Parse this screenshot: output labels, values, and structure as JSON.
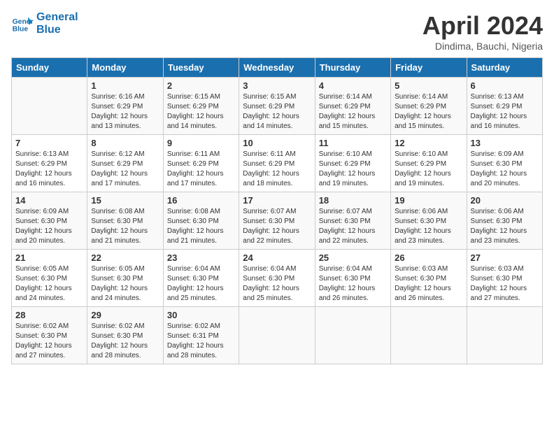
{
  "header": {
    "logo_line1": "General",
    "logo_line2": "Blue",
    "month_title": "April 2024",
    "location": "Dindima, Bauchi, Nigeria"
  },
  "days_of_week": [
    "Sunday",
    "Monday",
    "Tuesday",
    "Wednesday",
    "Thursday",
    "Friday",
    "Saturday"
  ],
  "weeks": [
    [
      {
        "day": "",
        "info": ""
      },
      {
        "day": "1",
        "info": "Sunrise: 6:16 AM\nSunset: 6:29 PM\nDaylight: 12 hours\nand 13 minutes."
      },
      {
        "day": "2",
        "info": "Sunrise: 6:15 AM\nSunset: 6:29 PM\nDaylight: 12 hours\nand 14 minutes."
      },
      {
        "day": "3",
        "info": "Sunrise: 6:15 AM\nSunset: 6:29 PM\nDaylight: 12 hours\nand 14 minutes."
      },
      {
        "day": "4",
        "info": "Sunrise: 6:14 AM\nSunset: 6:29 PM\nDaylight: 12 hours\nand 15 minutes."
      },
      {
        "day": "5",
        "info": "Sunrise: 6:14 AM\nSunset: 6:29 PM\nDaylight: 12 hours\nand 15 minutes."
      },
      {
        "day": "6",
        "info": "Sunrise: 6:13 AM\nSunset: 6:29 PM\nDaylight: 12 hours\nand 16 minutes."
      }
    ],
    [
      {
        "day": "7",
        "info": "Sunrise: 6:13 AM\nSunset: 6:29 PM\nDaylight: 12 hours\nand 16 minutes."
      },
      {
        "day": "8",
        "info": "Sunrise: 6:12 AM\nSunset: 6:29 PM\nDaylight: 12 hours\nand 17 minutes."
      },
      {
        "day": "9",
        "info": "Sunrise: 6:11 AM\nSunset: 6:29 PM\nDaylight: 12 hours\nand 17 minutes."
      },
      {
        "day": "10",
        "info": "Sunrise: 6:11 AM\nSunset: 6:29 PM\nDaylight: 12 hours\nand 18 minutes."
      },
      {
        "day": "11",
        "info": "Sunrise: 6:10 AM\nSunset: 6:29 PM\nDaylight: 12 hours\nand 19 minutes."
      },
      {
        "day": "12",
        "info": "Sunrise: 6:10 AM\nSunset: 6:29 PM\nDaylight: 12 hours\nand 19 minutes."
      },
      {
        "day": "13",
        "info": "Sunrise: 6:09 AM\nSunset: 6:30 PM\nDaylight: 12 hours\nand 20 minutes."
      }
    ],
    [
      {
        "day": "14",
        "info": "Sunrise: 6:09 AM\nSunset: 6:30 PM\nDaylight: 12 hours\nand 20 minutes."
      },
      {
        "day": "15",
        "info": "Sunrise: 6:08 AM\nSunset: 6:30 PM\nDaylight: 12 hours\nand 21 minutes."
      },
      {
        "day": "16",
        "info": "Sunrise: 6:08 AM\nSunset: 6:30 PM\nDaylight: 12 hours\nand 21 minutes."
      },
      {
        "day": "17",
        "info": "Sunrise: 6:07 AM\nSunset: 6:30 PM\nDaylight: 12 hours\nand 22 minutes."
      },
      {
        "day": "18",
        "info": "Sunrise: 6:07 AM\nSunset: 6:30 PM\nDaylight: 12 hours\nand 22 minutes."
      },
      {
        "day": "19",
        "info": "Sunrise: 6:06 AM\nSunset: 6:30 PM\nDaylight: 12 hours\nand 23 minutes."
      },
      {
        "day": "20",
        "info": "Sunrise: 6:06 AM\nSunset: 6:30 PM\nDaylight: 12 hours\nand 23 minutes."
      }
    ],
    [
      {
        "day": "21",
        "info": "Sunrise: 6:05 AM\nSunset: 6:30 PM\nDaylight: 12 hours\nand 24 minutes."
      },
      {
        "day": "22",
        "info": "Sunrise: 6:05 AM\nSunset: 6:30 PM\nDaylight: 12 hours\nand 24 minutes."
      },
      {
        "day": "23",
        "info": "Sunrise: 6:04 AM\nSunset: 6:30 PM\nDaylight: 12 hours\nand 25 minutes."
      },
      {
        "day": "24",
        "info": "Sunrise: 6:04 AM\nSunset: 6:30 PM\nDaylight: 12 hours\nand 25 minutes."
      },
      {
        "day": "25",
        "info": "Sunrise: 6:04 AM\nSunset: 6:30 PM\nDaylight: 12 hours\nand 26 minutes."
      },
      {
        "day": "26",
        "info": "Sunrise: 6:03 AM\nSunset: 6:30 PM\nDaylight: 12 hours\nand 26 minutes."
      },
      {
        "day": "27",
        "info": "Sunrise: 6:03 AM\nSunset: 6:30 PM\nDaylight: 12 hours\nand 27 minutes."
      }
    ],
    [
      {
        "day": "28",
        "info": "Sunrise: 6:02 AM\nSunset: 6:30 PM\nDaylight: 12 hours\nand 27 minutes."
      },
      {
        "day": "29",
        "info": "Sunrise: 6:02 AM\nSunset: 6:30 PM\nDaylight: 12 hours\nand 28 minutes."
      },
      {
        "day": "30",
        "info": "Sunrise: 6:02 AM\nSunset: 6:31 PM\nDaylight: 12 hours\nand 28 minutes."
      },
      {
        "day": "",
        "info": ""
      },
      {
        "day": "",
        "info": ""
      },
      {
        "day": "",
        "info": ""
      },
      {
        "day": "",
        "info": ""
      }
    ]
  ]
}
